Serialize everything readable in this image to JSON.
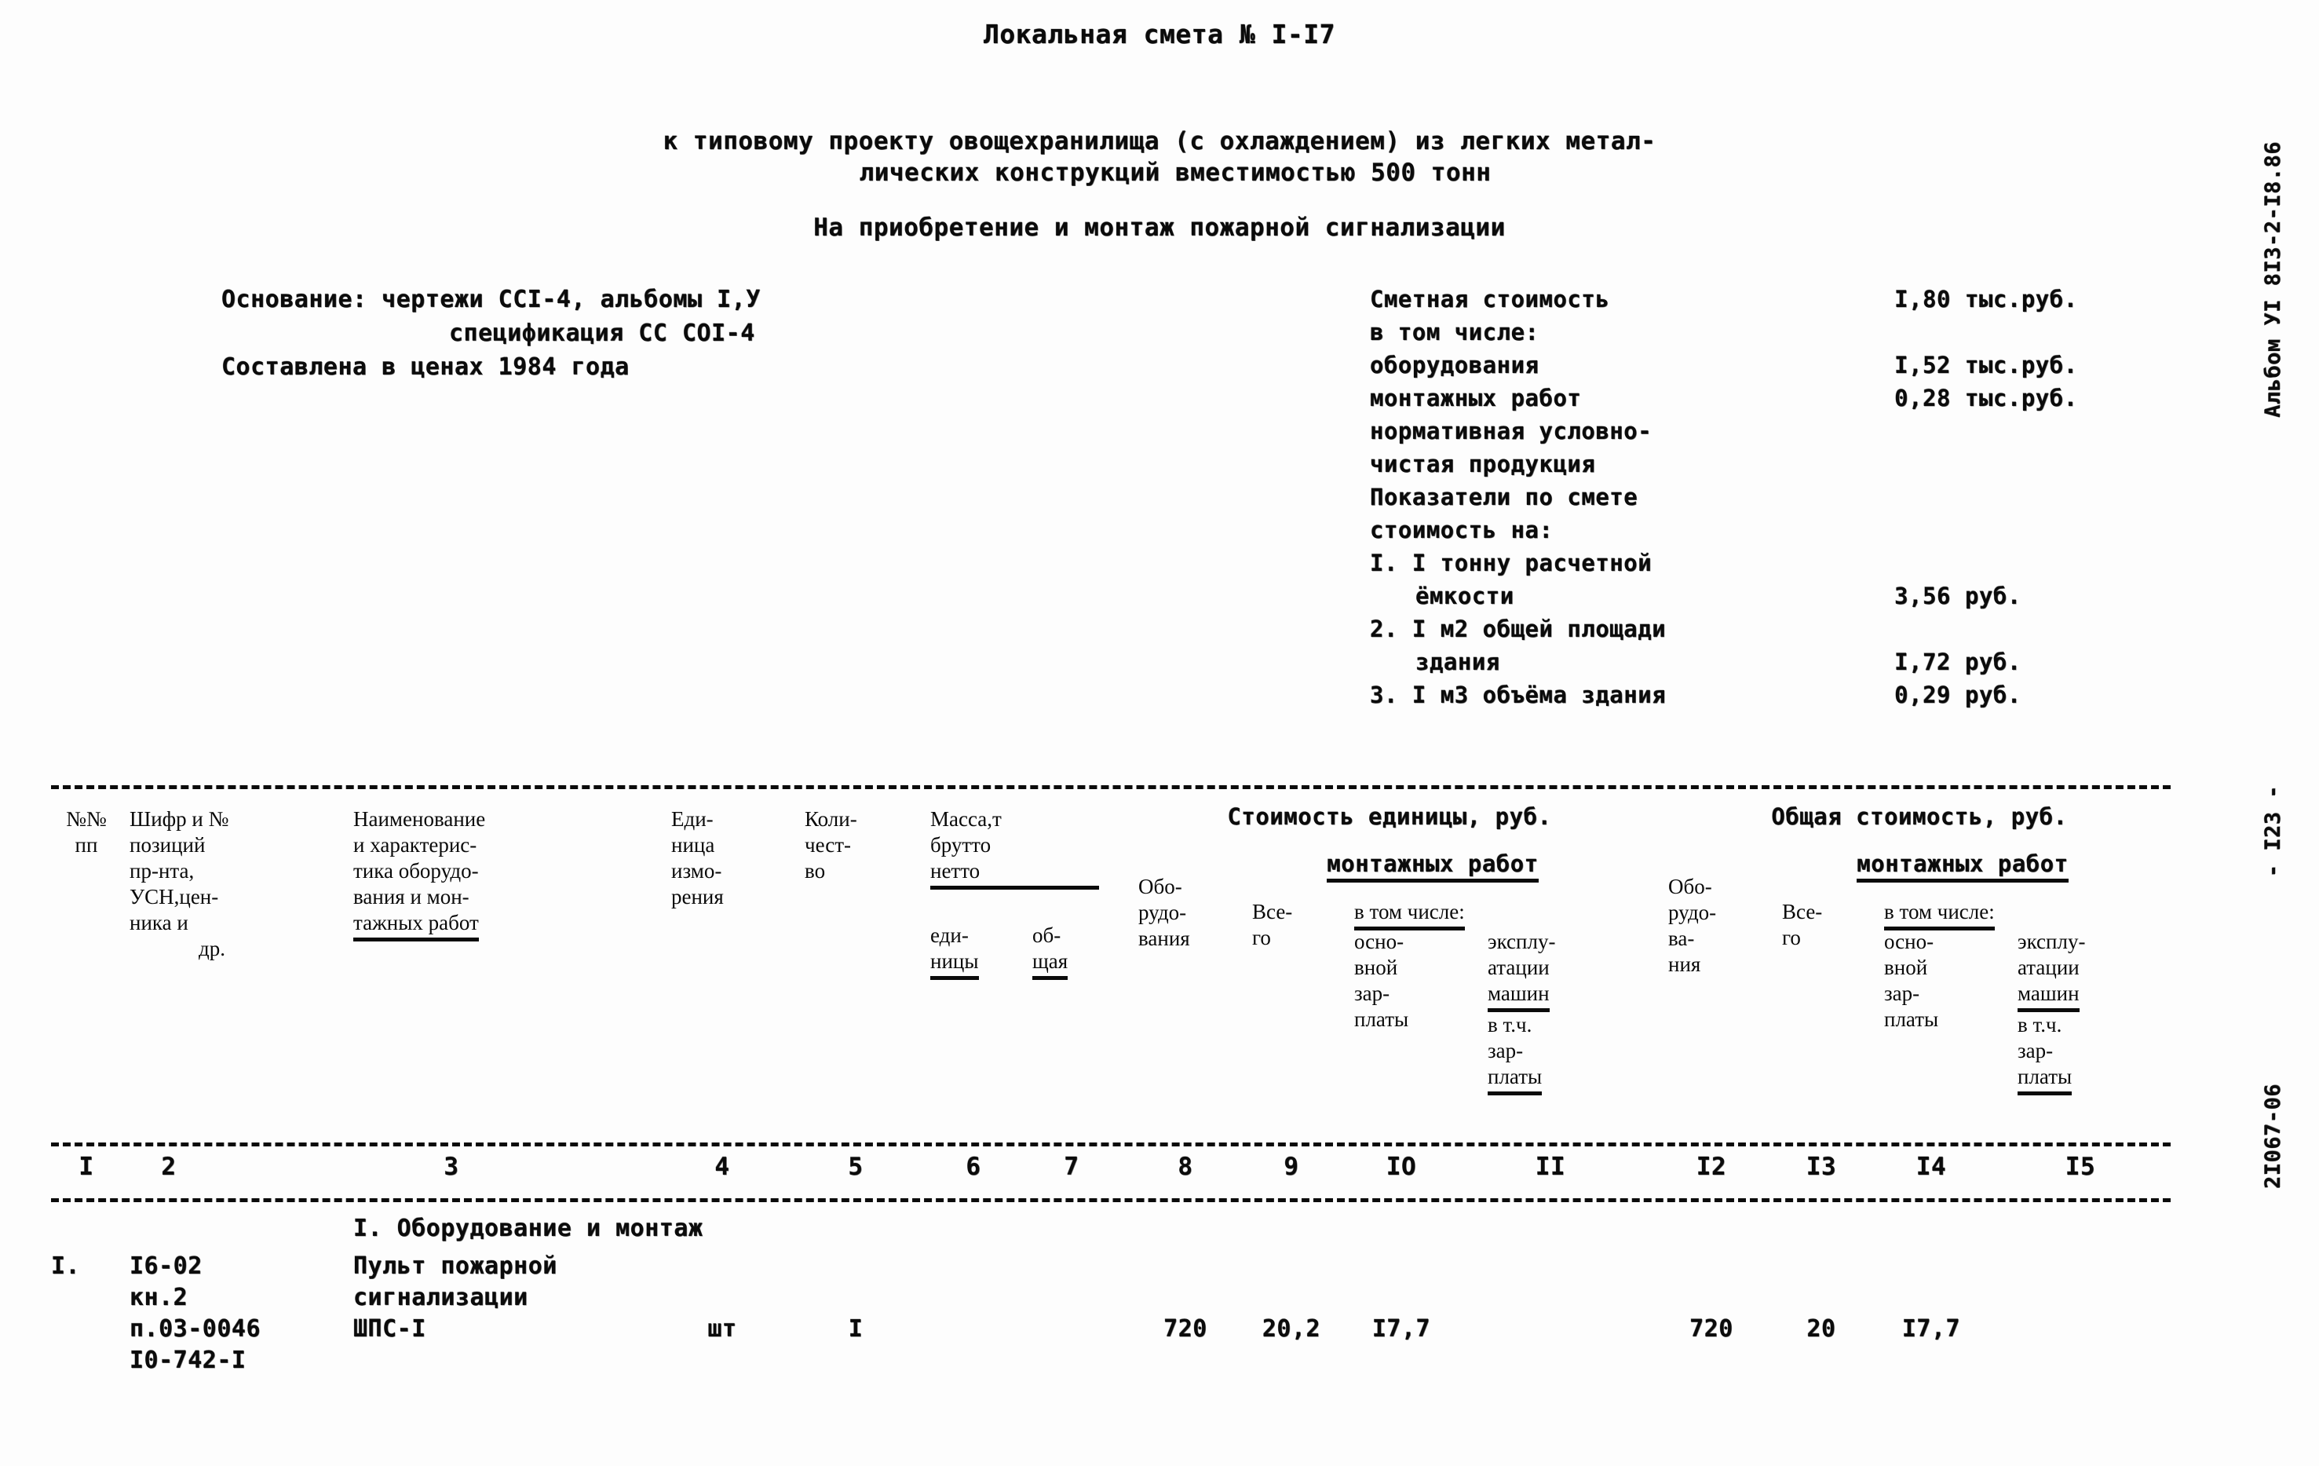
{
  "document": {
    "title": "Локальная смета № I-I7",
    "subtitle_line1": "к типовому проекту овощехранилища (с охлаждением) из легких метал-",
    "subtitle_line2": "лических конструкций вместимостью 500 тонн",
    "subtitle_line3": "На приобретение и монтаж пожарной сигнализации"
  },
  "basis": {
    "line1": "Основание: чертежи CCI-4, альбомы I,У",
    "line2": "спецификация СС COI-4",
    "line3": "Составлена в ценах 1984 года"
  },
  "summary": {
    "total_label": "Сметная стоимость",
    "total_value": "I,80",
    "total_unit": "тыс.руб.",
    "including_label": "в том числе:",
    "equipment_label": "оборудования",
    "equipment_value": "I,52",
    "equipment_unit": "тыс.руб.",
    "install_label": "монтажных работ",
    "install_value": "0,28",
    "install_unit": "тыс.руб.",
    "nucp_line1": "нормативная условно-",
    "nucp_line2": "чистая продукция",
    "indicators_label": "Показатели по смете",
    "cost_per_label": "стоимость на:",
    "item1_line1": "I. I тонну расчетной",
    "item1_line2": "ёмкости",
    "item1_value": "3,56",
    "item1_unit": "руб.",
    "item2_line1": "2. I м2 общей площади",
    "item2_line2": "здания",
    "item2_value": "I,72",
    "item2_unit": "руб.",
    "item3_line1": "3. I м3 объёма здания",
    "item3_value": "0,29",
    "item3_unit": "руб."
  },
  "margin_notes": {
    "album": "Альбом УI",
    "album2": "8I3-2-I8.86",
    "page": "- I23 -",
    "code": "2I067-06"
  },
  "table": {
    "headers": {
      "col1": "№№\nпп",
      "col1_l1": "№№",
      "col1_l2": "пп",
      "col2_l1": "Шифр и №",
      "col2_l2": "позиций",
      "col2_l3": "пр-нта,",
      "col2_l4": "УСН,цен-",
      "col2_l5": "ника и",
      "col2_l6": "др.",
      "col3_l1": "Наименование",
      "col3_l2": "и характерис-",
      "col3_l3": "тика оборудо-",
      "col3_l4": "вания и мон-",
      "col3_l5": "тажных работ",
      "col4_l1": "Еди-",
      "col4_l2": "ница",
      "col4_l3": "измо-",
      "col4_l4": "рения",
      "col5_l1": "Коли-",
      "col5_l2": "чест-",
      "col5_l3": "во",
      "mass_l1": "Масса,т",
      "mass_l2": "брутто",
      "mass_l3": "нетто",
      "col6_l1": "еди-",
      "col6_l2": "ницы",
      "col7_l1": "об-",
      "col7_l2": "щая",
      "unit_cost_span": "Стоимость единицы, руб.",
      "total_cost_span": "Общая стоимость, руб.",
      "install_span": "монтажных работ",
      "col8_l1": "Обо-",
      "col8_l2": "рудо-",
      "col8_l3": "вания",
      "col9_l1": "Все-",
      "col9_l2": "го",
      "in_total_label": "в том числе:",
      "col10_l1": "осно-",
      "col10_l2": "вной",
      "col10_l3": "зар-",
      "col10_l4": "платы",
      "col11_l1": "эксплу-",
      "col11_l2": "атации",
      "col11_l3": "машин",
      "col11_l4": "в т.ч.",
      "col11_l5": "зар-",
      "col11_l6": "платы",
      "col12_l1": "Обо-",
      "col12_l2": "рудо-",
      "col12_l3": "ва-",
      "col12_l4": "ния",
      "col13_l1": "Все-",
      "col13_l2": "го",
      "col14_l1": "осно-",
      "col14_l2": "вной",
      "col14_l3": "зар-",
      "col14_l4": "платы",
      "col15_l1": "эксплу-",
      "col15_l2": "атации",
      "col15_l3": "машин",
      "col15_l4": "в т.ч.",
      "col15_l5": "зар-",
      "col15_l6": "платы"
    },
    "column_numbers": [
      "I",
      "2",
      "3",
      "4",
      "5",
      "6",
      "7",
      "8",
      "9",
      "IO",
      "II",
      "I2",
      "I3",
      "I4",
      "I5"
    ],
    "section_title": "I. Оборудование и монтаж",
    "rows": [
      {
        "num": "I.",
        "code_l1": "I6-02",
        "code_l2": "кн.2",
        "code_l3": "п.03-0046",
        "code_l4": "I0-742-I",
        "name_l1": "Пульт пожарной",
        "name_l2": "сигнализации",
        "name_l3": "ШПС-I",
        "unit": "шт",
        "qty": "I",
        "mass_unit": "",
        "mass_total": "",
        "c8": "720",
        "c9": "20,2",
        "c10": "I7,7",
        "c11": "",
        "c12": "720",
        "c13": "20",
        "c14": "I7,7",
        "c15": ""
      }
    ]
  }
}
